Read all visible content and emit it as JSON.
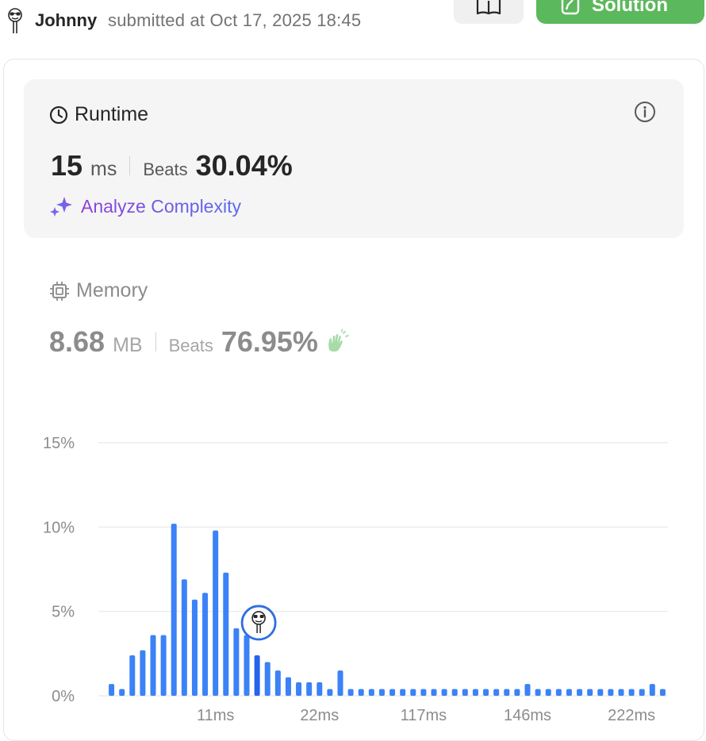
{
  "header": {
    "author": "Johnny",
    "submitted_text": "submitted at Oct 17, 2025 18:45",
    "editorial_icon": "book-icon",
    "solution_label": "Solution",
    "solution_icon": "edit-icon"
  },
  "runtime": {
    "title": "Runtime",
    "value": "15",
    "unit": "ms",
    "beats_label": "Beats",
    "beats_value": "30.04%",
    "analyze_label": "Analyze Complexity"
  },
  "memory": {
    "title": "Memory",
    "value": "8.68",
    "unit": "MB",
    "beats_label": "Beats",
    "beats_value": "76.95%"
  },
  "colors": {
    "bar": "#3b82f6",
    "bar_highlight": "#2563eb",
    "solution_green": "#5cb85c"
  },
  "chart_data": {
    "type": "bar",
    "title": "",
    "xlabel": "",
    "ylabel": "",
    "ylim": [
      0,
      15
    ],
    "y_ticks": [
      "0%",
      "5%",
      "10%",
      "15%"
    ],
    "x_tick_labels": [
      "11ms",
      "22ms",
      "117ms",
      "146ms",
      "222ms"
    ],
    "x_tick_bar_index": [
      10,
      20,
      30,
      40,
      50
    ],
    "values": [
      0.7,
      0.4,
      2.4,
      2.7,
      3.6,
      3.6,
      10.2,
      6.9,
      5.7,
      6.1,
      9.8,
      7.3,
      4.0,
      3.6,
      2.4,
      2.0,
      1.5,
      1.1,
      0.8,
      0.8,
      0.8,
      0.4,
      1.5,
      0.4,
      0.4,
      0.4,
      0.4,
      0.4,
      0.4,
      0.4,
      0.4,
      0.4,
      0.4,
      0.4,
      0.4,
      0.4,
      0.4,
      0.4,
      0.4,
      0.4,
      0.7,
      0.4,
      0.4,
      0.4,
      0.4,
      0.4,
      0.4,
      0.4,
      0.4,
      0.4,
      0.4,
      0.4,
      0.7,
      0.4
    ],
    "highlight_index": 14,
    "grid": true
  }
}
